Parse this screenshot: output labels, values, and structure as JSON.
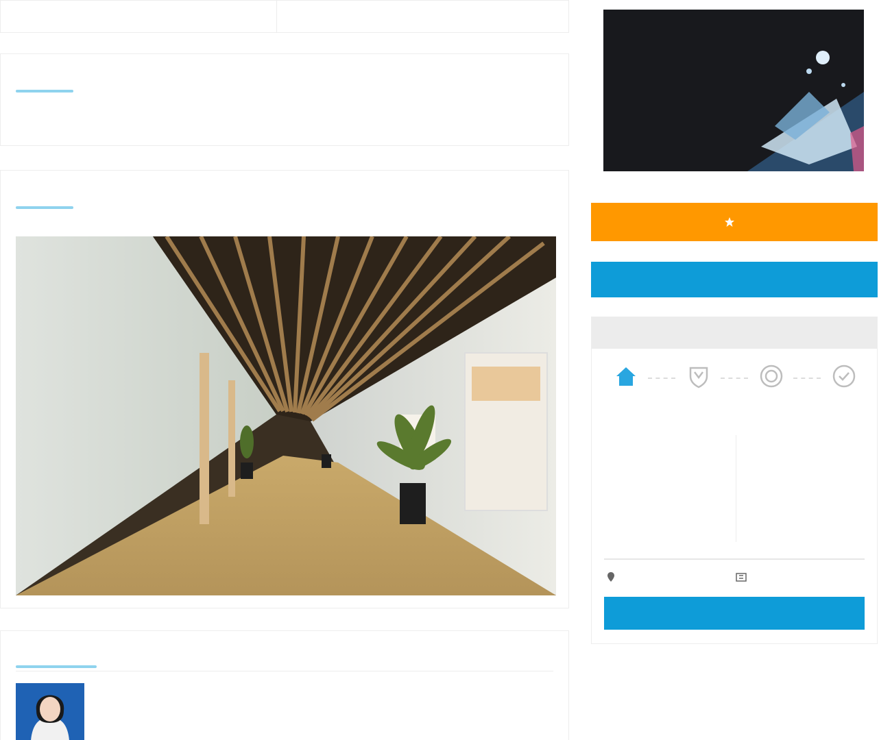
{
  "info_strip": {
    "label_1": "",
    "value_1": "",
    "label_2": "",
    "value_2": ""
  },
  "intro": {
    "title": "",
    "text": ""
  },
  "photos": {
    "title": ""
  },
  "consultant": {
    "title": "",
    "line1": "",
    "line2": ""
  },
  "promo": {
    "headline": "",
    "subtitle": ""
  },
  "actions": {
    "orange_button": "",
    "blue_button": ""
  },
  "panel": {
    "header": "",
    "steps": [
      {
        "label": "",
        "icon": "home-icon"
      },
      {
        "label": "",
        "icon": "shield-icon"
      },
      {
        "label": "",
        "icon": "target-icon"
      },
      {
        "label": "",
        "icon": "clock-check-icon"
      }
    ],
    "fields": [
      {
        "label": "",
        "value": ""
      },
      {
        "label": "",
        "value": ""
      },
      {
        "label": "",
        "value": ""
      },
      {
        "label": "",
        "value": ""
      }
    ],
    "bottom_left": "",
    "bottom_right": "",
    "submit": ""
  },
  "colors": {
    "accent_blue": "#0e9cd8",
    "accent_orange": "#ff9800",
    "underline": "#8fd3ee"
  }
}
